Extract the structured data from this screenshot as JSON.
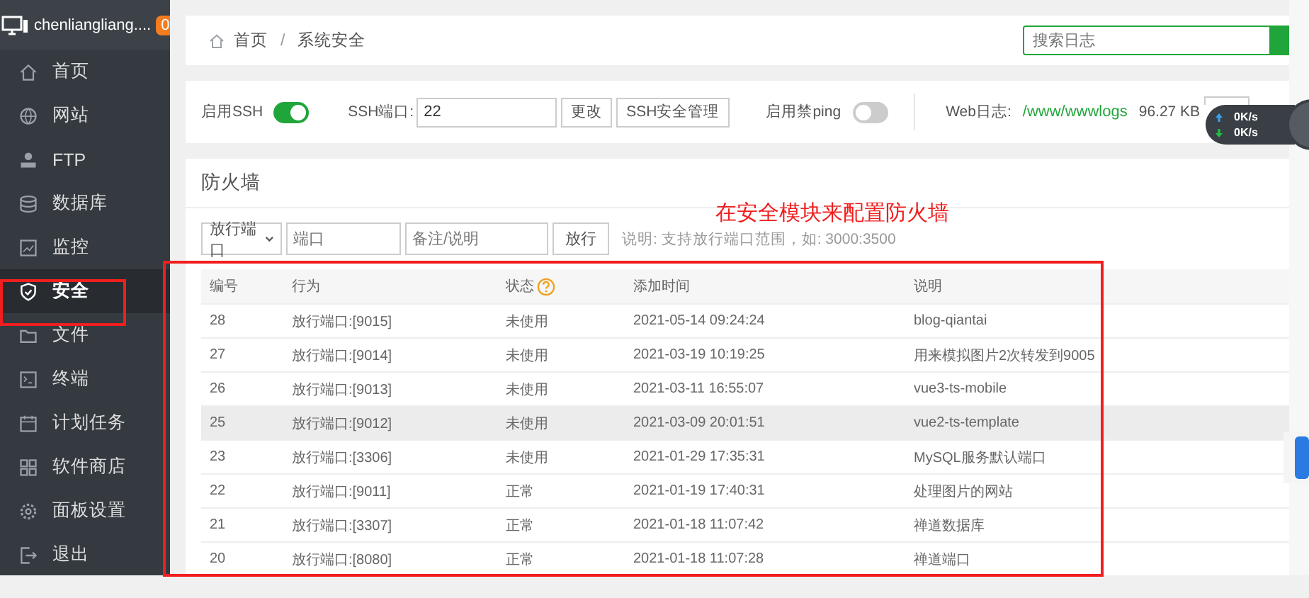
{
  "sidebar": {
    "user": "chenliangliang....",
    "badge": "0",
    "items": [
      {
        "label": "首页",
        "selected": false
      },
      {
        "label": "网站",
        "selected": false
      },
      {
        "label": "FTP",
        "selected": false
      },
      {
        "label": "数据库",
        "selected": false
      },
      {
        "label": "监控",
        "selected": false
      },
      {
        "label": "安全",
        "selected": true
      },
      {
        "label": "文件",
        "selected": false
      },
      {
        "label": "终端",
        "selected": false
      },
      {
        "label": "计划任务",
        "selected": false
      },
      {
        "label": "软件商店",
        "selected": false
      },
      {
        "label": "面板设置",
        "selected": false
      },
      {
        "label": "退出",
        "selected": false
      }
    ]
  },
  "breadcrumb": {
    "items": [
      "首页",
      "系统安全"
    ],
    "separator": "/"
  },
  "log_search": {
    "placeholder": "搜索日志"
  },
  "ssh": {
    "label": "启用SSH",
    "on": true,
    "port_label": "SSH端口:",
    "port": "22",
    "change_button": "更改",
    "manage_button": "SSH安全管理",
    "ping_label": "启用禁ping",
    "ping_on": false,
    "weblog_label": "Web日志:",
    "weblog_path": "/www/wwwlogs",
    "weblog_size": "96.27 KB"
  },
  "firewall": {
    "title": "防火墙",
    "type_select": "放行端口",
    "port_placeholder": "端口",
    "note_placeholder": "备注/说明",
    "allow_button": "放行",
    "hint": "说明: 支持放行端口范围，如: 3000:3500",
    "columns": [
      "编号",
      "行为",
      "状态",
      "添加时间",
      "说明"
    ],
    "rows": [
      {
        "id": "28",
        "action": "放行端口:[9015]",
        "status": "未使用",
        "time": "2021-05-14 09:24:24",
        "note": "blog-qiantai",
        "highlighted": false
      },
      {
        "id": "27",
        "action": "放行端口:[9014]",
        "status": "未使用",
        "time": "2021-03-19 10:19:25",
        "note": "用来模拟图片2次转发到9005",
        "highlighted": false
      },
      {
        "id": "26",
        "action": "放行端口:[9013]",
        "status": "未使用",
        "time": "2021-03-11 16:55:07",
        "note": "vue3-ts-mobile",
        "highlighted": false
      },
      {
        "id": "25",
        "action": "放行端口:[9012]",
        "status": "未使用",
        "time": "2021-03-09 20:01:51",
        "note": "vue2-ts-template",
        "highlighted": true
      },
      {
        "id": "23",
        "action": "放行端口:[3306]",
        "status": "未使用",
        "time": "2021-01-29 17:35:31",
        "note": "MySQL服务默认端口",
        "highlighted": false
      },
      {
        "id": "22",
        "action": "放行端口:[9011]",
        "status": "正常",
        "time": "2021-01-19 17:40:31",
        "note": "处理图片的网站",
        "highlighted": false
      },
      {
        "id": "21",
        "action": "放行端口:[3307]",
        "status": "正常",
        "time": "2021-01-18 11:07:42",
        "note": "禅道数据库",
        "highlighted": false
      },
      {
        "id": "20",
        "action": "放行端口:[8080]",
        "status": "正常",
        "time": "2021-01-18 11:07:28",
        "note": "禅道端口",
        "highlighted": false
      }
    ]
  },
  "net_widget": {
    "up": "0K/s",
    "down": "0K/s"
  },
  "annotation": {
    "text": "在安全模块来配置防火墙"
  }
}
